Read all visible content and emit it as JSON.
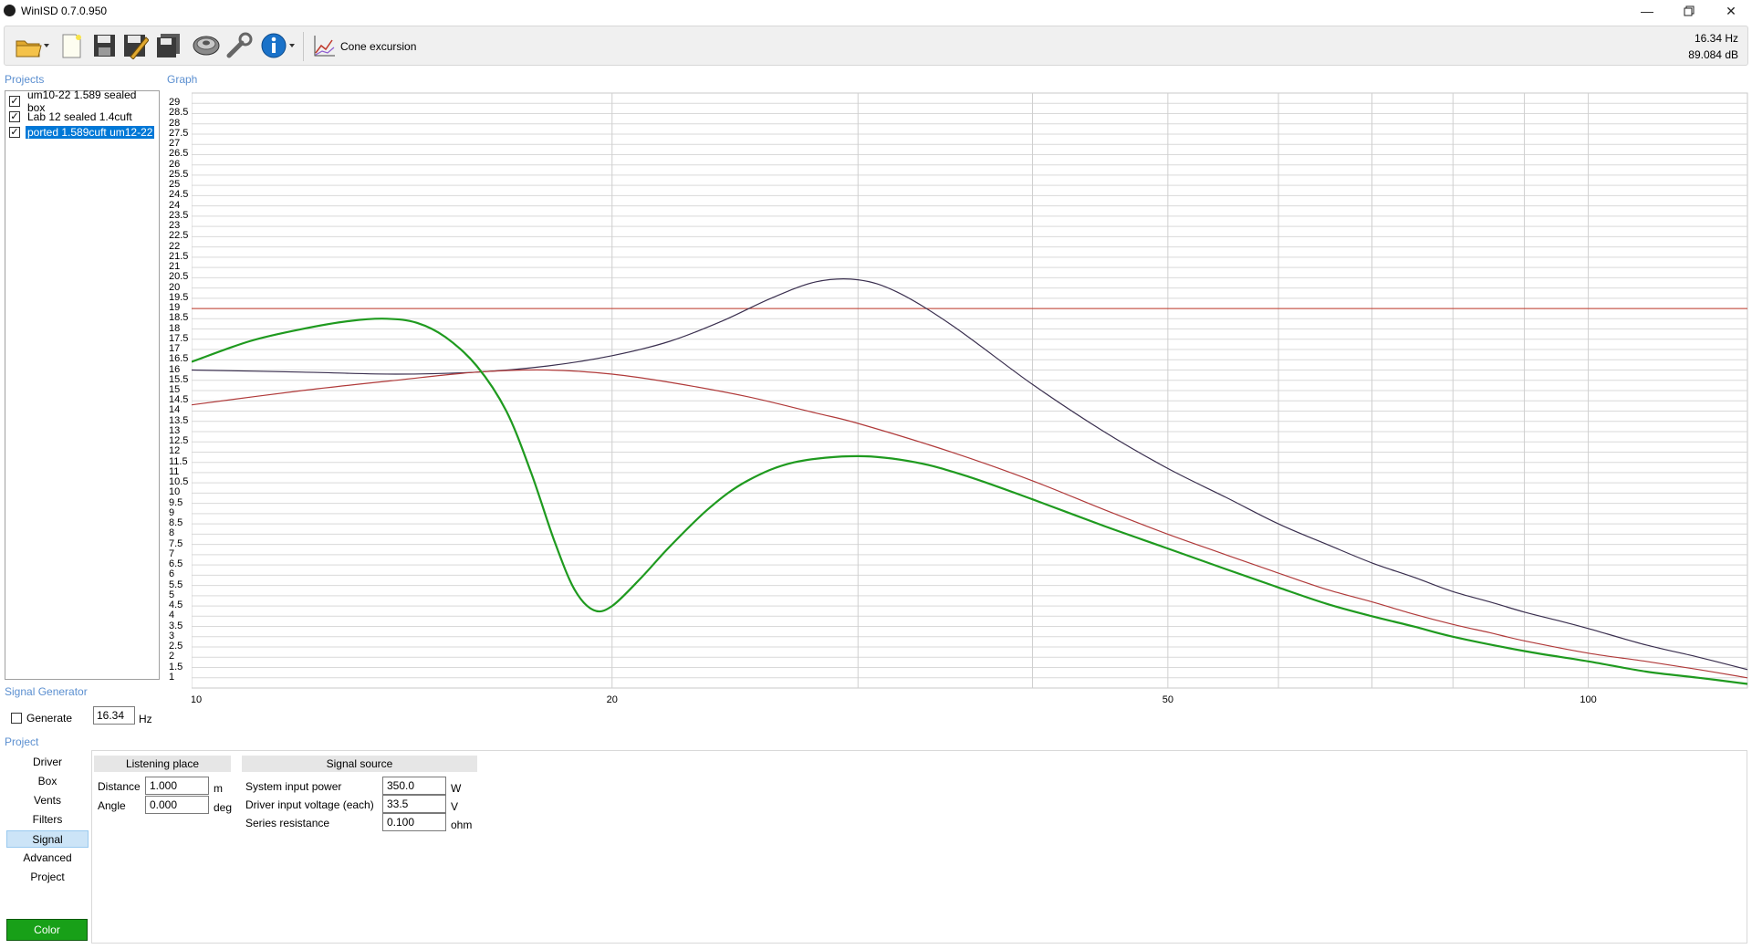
{
  "window": {
    "title": "WinISD 0.7.0.950"
  },
  "toolbar": {
    "items": [
      "open-icon",
      "new-icon",
      "save-icon",
      "save-as-icon",
      "save-all-icon",
      "driver-icon",
      "tools-icon",
      "info-icon"
    ],
    "graph_type_label": "Cone excursion",
    "status_freq": "16.34 Hz",
    "status_level": "89.084 dB"
  },
  "projects": {
    "header": "Projects",
    "items": [
      {
        "label": "um10-22 1.589 sealed box",
        "checked": true,
        "selected": false
      },
      {
        "label": "Lab 12 sealed 1.4cuft",
        "checked": true,
        "selected": false
      },
      {
        "label": "ported 1.589cuft um12-22",
        "checked": true,
        "selected": true
      }
    ]
  },
  "graph": {
    "header": "Graph"
  },
  "signal_generator": {
    "header": "Signal Generator",
    "generate_label": "Generate",
    "generate_checked": false,
    "frequency": "16.34",
    "unit": "Hz"
  },
  "project_nav": {
    "header": "Project",
    "items": [
      "Driver",
      "Box",
      "Vents",
      "Filters",
      "Signal",
      "Advanced",
      "Project"
    ],
    "selected": "Signal",
    "color_button": "Color",
    "color_value": "#18a018"
  },
  "listening_place": {
    "title": "Listening place",
    "distance_label": "Distance",
    "distance_value": "1.000",
    "distance_unit": "m",
    "angle_label": "Angle",
    "angle_value": "0.000",
    "angle_unit": "deg"
  },
  "signal_source": {
    "title": "Signal source",
    "power_label": "System input power",
    "power_value": "350.0",
    "power_unit": "W",
    "voltage_label": "Driver input voltage (each)",
    "voltage_value": "33.5",
    "voltage_unit": "V",
    "resistance_label": "Series resistance",
    "resistance_value": "0.100",
    "resistance_unit": "ohm"
  },
  "chart_data": {
    "type": "line",
    "xlabel": "",
    "ylabel": "",
    "x_scale": "log",
    "xlim": [
      10,
      130
    ],
    "ylim": [
      0.5,
      29.5
    ],
    "x_tick_labels": [
      "10",
      "20",
      "50",
      "100"
    ],
    "x_ticks": [
      10,
      20,
      50,
      100
    ],
    "x_grid": [
      10,
      20,
      30,
      40,
      50,
      60,
      70,
      80,
      90,
      100
    ],
    "y_ticks": [
      1,
      1.5,
      2,
      2.5,
      3,
      3.5,
      4,
      4.5,
      5,
      5.5,
      6,
      6.5,
      7,
      7.5,
      8,
      8.5,
      9,
      9.5,
      10,
      10.5,
      11,
      11.5,
      12,
      12.5,
      13,
      13.5,
      14,
      14.5,
      15,
      15.5,
      16,
      16.5,
      17,
      17.5,
      18,
      18.5,
      19,
      19.5,
      20,
      20.5,
      21,
      21.5,
      22,
      22.5,
      23,
      23.5,
      24,
      24.5,
      25,
      25.5,
      26,
      26.5,
      27,
      27.5,
      28,
      28.5,
      29
    ],
    "grid": true,
    "limit_line": {
      "y": 19,
      "color": "#c0392b"
    },
    "series": [
      {
        "color": "#3a2f4f",
        "width": 1.2,
        "points": [
          [
            10,
            16.0
          ],
          [
            12,
            15.9
          ],
          [
            14,
            15.8
          ],
          [
            16,
            15.9
          ],
          [
            18,
            16.2
          ],
          [
            20,
            16.7
          ],
          [
            22,
            17.4
          ],
          [
            24,
            18.4
          ],
          [
            26,
            19.5
          ],
          [
            28,
            20.3
          ],
          [
            30,
            20.4
          ],
          [
            32,
            19.8
          ],
          [
            35,
            18.2
          ],
          [
            40,
            15.3
          ],
          [
            45,
            13.0
          ],
          [
            50,
            11.2
          ],
          [
            55,
            9.8
          ],
          [
            60,
            8.5
          ],
          [
            65,
            7.5
          ],
          [
            70,
            6.6
          ],
          [
            75,
            5.9
          ],
          [
            80,
            5.2
          ],
          [
            85,
            4.7
          ],
          [
            90,
            4.2
          ],
          [
            95,
            3.8
          ],
          [
            100,
            3.4
          ],
          [
            110,
            2.6
          ],
          [
            120,
            2.0
          ],
          [
            130,
            1.4
          ]
        ]
      },
      {
        "color": "#b03a3a",
        "width": 1.2,
        "points": [
          [
            10,
            14.3
          ],
          [
            12,
            15.0
          ],
          [
            14,
            15.5
          ],
          [
            16,
            15.9
          ],
          [
            18,
            16.0
          ],
          [
            20,
            15.8
          ],
          [
            22,
            15.4
          ],
          [
            25,
            14.7
          ],
          [
            28,
            13.9
          ],
          [
            30,
            13.4
          ],
          [
            35,
            12.0
          ],
          [
            40,
            10.6
          ],
          [
            45,
            9.2
          ],
          [
            50,
            8.0
          ],
          [
            55,
            7.0
          ],
          [
            60,
            6.1
          ],
          [
            65,
            5.3
          ],
          [
            70,
            4.7
          ],
          [
            75,
            4.1
          ],
          [
            80,
            3.6
          ],
          [
            85,
            3.2
          ],
          [
            90,
            2.8
          ],
          [
            100,
            2.2
          ],
          [
            110,
            1.8
          ],
          [
            120,
            1.4
          ],
          [
            130,
            1.0
          ]
        ]
      },
      {
        "color": "#1f9a1f",
        "width": 2.2,
        "points": [
          [
            10,
            16.4
          ],
          [
            11,
            17.4
          ],
          [
            12,
            18.0
          ],
          [
            13,
            18.4
          ],
          [
            13.8,
            18.5
          ],
          [
            14.5,
            18.3
          ],
          [
            15.2,
            17.6
          ],
          [
            16,
            16.2
          ],
          [
            16.8,
            14.0
          ],
          [
            17.5,
            11.0
          ],
          [
            18.2,
            7.6
          ],
          [
            18.8,
            5.3
          ],
          [
            19.4,
            4.3
          ],
          [
            20,
            4.5
          ],
          [
            21,
            5.9
          ],
          [
            22,
            7.4
          ],
          [
            23.5,
            9.3
          ],
          [
            25,
            10.6
          ],
          [
            27,
            11.5
          ],
          [
            30,
            11.8
          ],
          [
            33,
            11.5
          ],
          [
            36,
            10.8
          ],
          [
            40,
            9.7
          ],
          [
            45,
            8.4
          ],
          [
            50,
            7.3
          ],
          [
            55,
            6.3
          ],
          [
            60,
            5.4
          ],
          [
            65,
            4.6
          ],
          [
            70,
            4.0
          ],
          [
            75,
            3.5
          ],
          [
            80,
            3.0
          ],
          [
            90,
            2.3
          ],
          [
            100,
            1.8
          ],
          [
            110,
            1.3
          ],
          [
            120,
            1.0
          ],
          [
            130,
            0.7
          ]
        ]
      }
    ]
  }
}
